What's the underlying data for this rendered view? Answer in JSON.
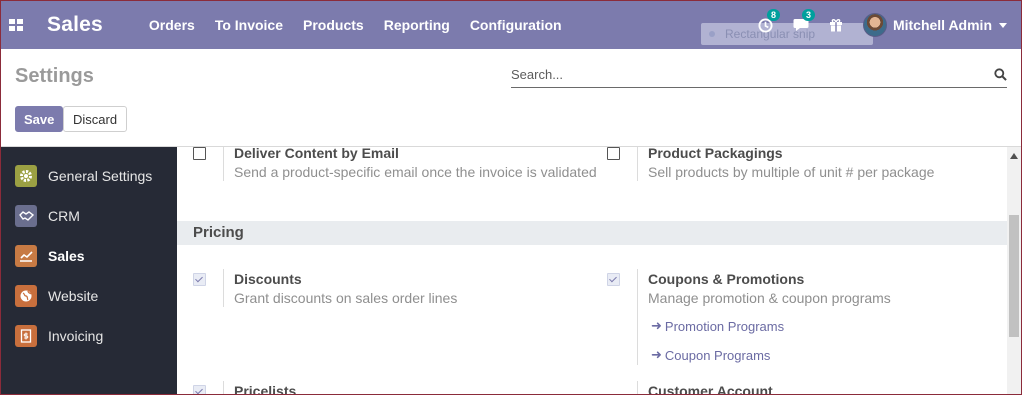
{
  "navbar": {
    "brand": "Sales",
    "menu": [
      "Orders",
      "To Invoice",
      "Products",
      "Reporting",
      "Configuration"
    ],
    "ghost_tooltip": "Rectangular snip",
    "activity_count": "8",
    "messages_count": "3",
    "user_name": "Mitchell Admin",
    "color": "#7c7bad"
  },
  "control_panel": {
    "title": "Settings",
    "search_placeholder": "Search...",
    "save_label": "Save",
    "discard_label": "Discard"
  },
  "sidebar": {
    "items": [
      {
        "label": "General Settings",
        "icon": "gear-icon",
        "color": "#9ba043",
        "active": false
      },
      {
        "label": "CRM",
        "icon": "handshake-icon",
        "color": "#6a6e8e",
        "active": false
      },
      {
        "label": "Sales",
        "icon": "chart-icon",
        "color": "#c77a44",
        "active": true
      },
      {
        "label": "Website",
        "icon": "globe-icon",
        "color": "#c86f3d",
        "active": false
      },
      {
        "label": "Invoicing",
        "icon": "invoice-icon",
        "color": "#c86f3d",
        "active": false
      }
    ]
  },
  "content": {
    "deliver": {
      "title": "Deliver Content by Email",
      "desc": "Send a product-specific email once the invoice is validated",
      "checked": false
    },
    "packaging": {
      "title": "Product Packagings",
      "desc": "Sell products by multiple of unit # per package",
      "checked": false
    },
    "pricing_header": "Pricing",
    "discounts": {
      "title": "Discounts",
      "desc": "Grant discounts on sales order lines",
      "checked": true
    },
    "coupons": {
      "title": "Coupons & Promotions",
      "desc": "Manage promotion & coupon programs",
      "checked": true,
      "links": [
        "Promotion Programs",
        "Coupon Programs"
      ]
    },
    "pricelists": {
      "title": "Pricelists",
      "checked": true
    },
    "customer_account": {
      "title": "Customer Account"
    }
  }
}
